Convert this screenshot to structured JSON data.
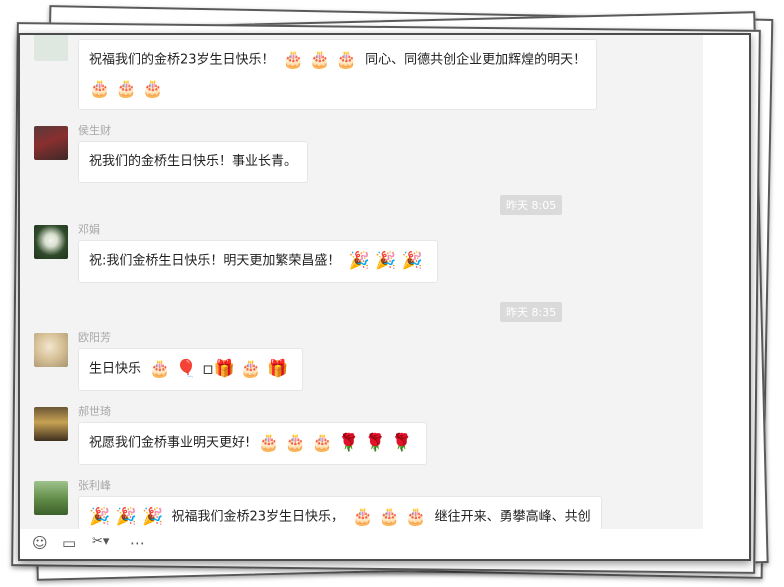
{
  "messages": [
    {
      "name": "",
      "text": "祝福我们的金桥23岁生日快乐！",
      "emoji_a": "🎂 🎂 🎂",
      "text2": "同心、同德共创企业更加辉煌的明天！",
      "emoji_b": "🎂 🎂 🎂"
    },
    {
      "name": "侯生财",
      "text": "祝我们的金桥生日快乐！事业长青。"
    },
    {
      "time": "昨天 8:05"
    },
    {
      "name": "邓娟",
      "text": "祝:我们金桥生日快乐！明天更加繁荣昌盛！",
      "emoji": "🎉 🎉 🎉"
    },
    {
      "time": "昨天 8:35"
    },
    {
      "name": "欧阳芳",
      "text": "生日快乐",
      "emoji": "🎂 🎈 ▫🎁 🎂 🎁"
    },
    {
      "name": "郝世琦",
      "text": "祝愿我们金桥事业明天更好!",
      "emoji": "🎂 🎂 🎂 🌹 🌹 🌹"
    },
    {
      "name": "张利峰",
      "emoji_a": "🎉 🎉 🎉",
      "text": "祝福我们金桥23岁生日快乐，",
      "emoji_b": "🎂 🎂 🎂",
      "text2": "继往开来、勇攀高峰、共创"
    }
  ],
  "toolbar": {
    "emoji_icon": "☺",
    "folder_icon": "▭",
    "scissors_icon": "✂▾",
    "chat_icon": "⋯"
  }
}
